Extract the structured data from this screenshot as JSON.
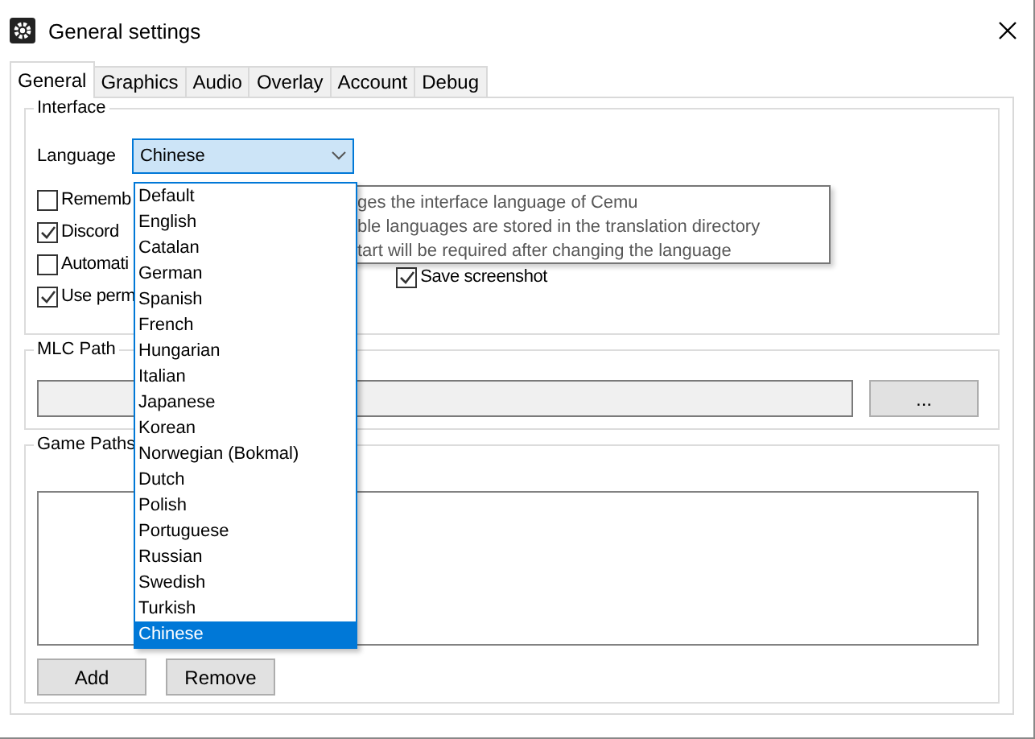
{
  "window": {
    "title": "General settings"
  },
  "tabs": [
    {
      "label": "General",
      "selected": true
    },
    {
      "label": "Graphics",
      "selected": false
    },
    {
      "label": "Audio",
      "selected": false
    },
    {
      "label": "Overlay",
      "selected": false
    },
    {
      "label": "Account",
      "selected": false
    },
    {
      "label": "Debug",
      "selected": false
    }
  ],
  "interface": {
    "title": "Interface",
    "language_label": "Language",
    "language_value": "Chinese",
    "checkboxes": [
      {
        "label": "Rememb",
        "checked": false
      },
      {
        "label": "Discord",
        "checked": true
      },
      {
        "label": "Automati",
        "checked": false
      },
      {
        "label": "Use perm",
        "checked": true
      }
    ],
    "right_checkbox": {
      "label": "Save screenshot",
      "checked": true
    }
  },
  "dropdown": {
    "items": [
      {
        "label": "Default",
        "selected": false
      },
      {
        "label": "English",
        "selected": false
      },
      {
        "label": "Catalan",
        "selected": false
      },
      {
        "label": "German",
        "selected": false
      },
      {
        "label": "Spanish",
        "selected": false
      },
      {
        "label": "French",
        "selected": false
      },
      {
        "label": "Hungarian",
        "selected": false
      },
      {
        "label": "Italian",
        "selected": false
      },
      {
        "label": "Japanese",
        "selected": false
      },
      {
        "label": "Korean",
        "selected": false
      },
      {
        "label": "Norwegian (Bokmal)",
        "selected": false
      },
      {
        "label": "Dutch",
        "selected": false
      },
      {
        "label": "Polish",
        "selected": false
      },
      {
        "label": "Portuguese",
        "selected": false
      },
      {
        "label": "Russian",
        "selected": false
      },
      {
        "label": "Swedish",
        "selected": false
      },
      {
        "label": "Turkish",
        "selected": false
      },
      {
        "label": "Chinese",
        "selected": true
      }
    ]
  },
  "tooltip": {
    "lines": [
      "ges the interface language of Cemu",
      "ble languages are stored in the translation directory",
      "tart will be required after changing the language"
    ]
  },
  "mlc_path": {
    "title": "MLC Path",
    "browse_button": "..."
  },
  "game_paths": {
    "title": "Game Paths",
    "buttons": [
      "Add",
      "Remove"
    ]
  }
}
